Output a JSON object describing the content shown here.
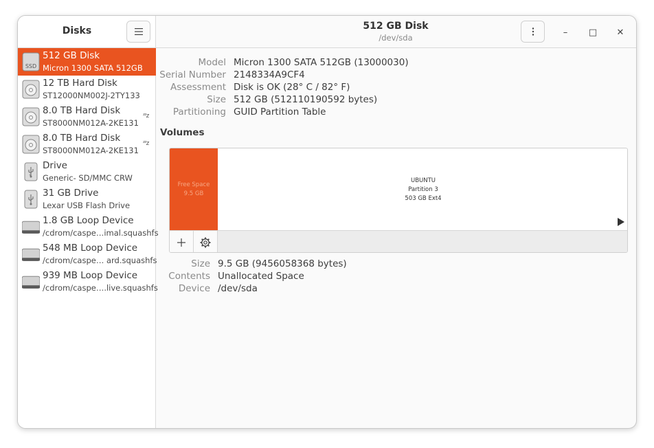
{
  "sidebar": {
    "title": "Disks",
    "disks": [
      {
        "name": "512 GB Disk",
        "sub": "Micron 1300 SATA 512GB",
        "kind": "ssd",
        "icon_label": "SSD",
        "selected": true,
        "sleeping": false
      },
      {
        "name": "12 TB Hard Disk",
        "sub": "ST12000NM002J-2TY133",
        "kind": "hdd",
        "selected": false,
        "sleeping": false
      },
      {
        "name": "8.0 TB Hard Disk",
        "sub": "ST8000NM012A-2KE131",
        "kind": "hdd",
        "selected": false,
        "sleeping": true
      },
      {
        "name": "8.0 TB Hard Disk",
        "sub": "ST8000NM012A-2KE131",
        "kind": "hdd",
        "selected": false,
        "sleeping": true
      },
      {
        "name": "Drive",
        "sub": "Generic- SD/MMC CRW",
        "kind": "usb",
        "selected": false,
        "sleeping": false
      },
      {
        "name": "31 GB Drive",
        "sub": "Lexar USB Flash Drive",
        "kind": "usb",
        "selected": false,
        "sleeping": false
      },
      {
        "name": "1.8 GB Loop Device",
        "sub": "/cdrom/caspe…imal.squashfs",
        "kind": "loop",
        "selected": false,
        "sleeping": false
      },
      {
        "name": "548 MB Loop Device",
        "sub": "/cdrom/caspe… ard.squashfs",
        "kind": "loop",
        "selected": false,
        "sleeping": false
      },
      {
        "name": "939 MB Loop Device",
        "sub": "/cdrom/caspe….live.squashfs",
        "kind": "loop",
        "selected": false,
        "sleeping": false
      }
    ],
    "sleep_glyph": "ᶻᶻz"
  },
  "header": {
    "title": "512 GB Disk",
    "subtitle": "/dev/sda",
    "menu_icon": "kebab-menu-icon",
    "minimize_glyph": "–",
    "maximize_glyph": "□",
    "close_glyph": "✕"
  },
  "properties": [
    {
      "label": "Model",
      "value": "Micron 1300 SATA 512GB (13000030)"
    },
    {
      "label": "Serial Number",
      "value": "2148334A9CF4"
    },
    {
      "label": "Assessment",
      "value": "Disk is OK (28° C / 82° F)"
    },
    {
      "label": "Size",
      "value": "512 GB (512110190592 bytes)"
    },
    {
      "label": "Partitioning",
      "value": "GUID Partition Table"
    }
  ],
  "volumes": {
    "title": "Volumes",
    "free": {
      "line1": "Free Space",
      "line2": "9.5 GB"
    },
    "ubuntu": {
      "line1": "UBUNTU",
      "line2": "Partition 3",
      "line3": "503 GB Ext4"
    },
    "accent": "#e95420"
  },
  "selected_volume": [
    {
      "label": "Size",
      "value": "9.5 GB (9456058368 bytes)"
    },
    {
      "label": "Contents",
      "value": "Unallocated Space"
    },
    {
      "label": "Device",
      "value": "/dev/sda"
    }
  ]
}
